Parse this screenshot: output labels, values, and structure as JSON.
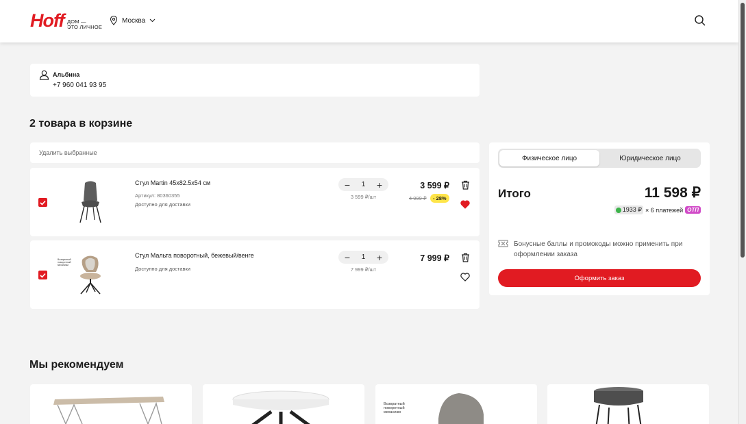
{
  "header": {
    "logo": "Hoff",
    "tagline_line1": "ДОМ —",
    "tagline_line2": "ЭТО ЛИЧНОЕ",
    "city": "Москва"
  },
  "user": {
    "name": "Альбина",
    "phone": "+7 960 041 93 95"
  },
  "cart": {
    "title": "2 товара в корзине",
    "delete_selected": "Удалить выбранные",
    "items": [
      {
        "name": "Стул Martin 45x82.5x54 см",
        "sku": "Артикул: 80360355",
        "availability": "Доступно для доставки",
        "quantity": "1",
        "minus": "−",
        "plus": "+",
        "unit_price": "3 599 ₽/шт",
        "price": "3 599 ₽",
        "old_price": "4 999 ₽",
        "discount": "- 28%",
        "favorited": true
      },
      {
        "name": "Стул Мальта поворотный, бежевый/венге",
        "image_caption": "Возвратный поворотный механизм",
        "availability": "Доступно для доставки",
        "quantity": "1",
        "minus": "−",
        "plus": "+",
        "unit_price": "7 999 ₽/шт",
        "price": "7 999 ₽",
        "favorited": false
      }
    ]
  },
  "summary": {
    "tab_individual": "Физическое лицо",
    "tab_legal": "Юридическое лицо",
    "total_label": "Итого",
    "total_value": "11 598 ₽",
    "installment_amount": "1933 ₽",
    "installment_text": "× 6 платежей",
    "installment_badge": "ОТП",
    "promo_text": "Бонусные баллы и промокоды можно применить при оформлении заказа",
    "checkout_button": "Оформить заказ"
  },
  "recommendations": {
    "title": "Мы рекомендуем",
    "card3_caption": "Возвратный поворотный механизм"
  },
  "colors": {
    "brand": "#e11b22",
    "discount_badge": "#ffe54a",
    "otp_badge": "#d14cc8"
  }
}
